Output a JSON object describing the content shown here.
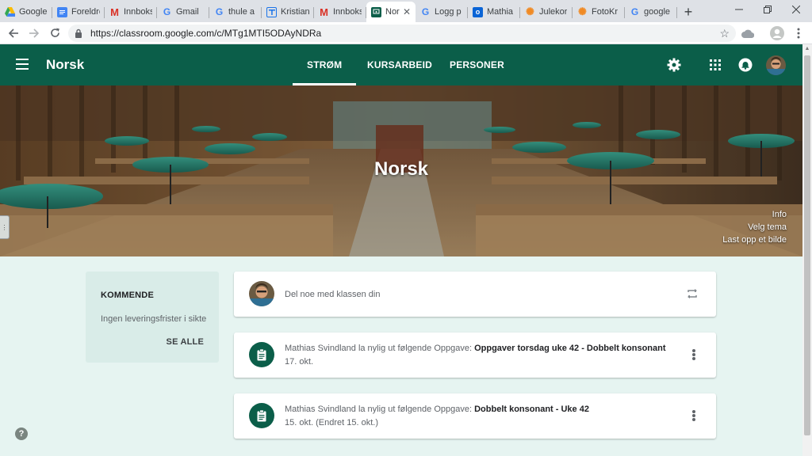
{
  "browser": {
    "tabs": [
      {
        "title": "Google",
        "icon": "google-drive-icon",
        "active": false
      },
      {
        "title": "Foreldre",
        "icon": "google-docs-icon",
        "active": false
      },
      {
        "title": "Innboks",
        "icon": "gmail-icon",
        "active": false
      },
      {
        "title": "Gmail",
        "icon": "google-g-icon",
        "active": false
      },
      {
        "title": "thule a",
        "icon": "google-g-icon",
        "active": false
      },
      {
        "title": "Kristian",
        "icon": "google-forms-icon",
        "active": false
      },
      {
        "title": "Innboks",
        "icon": "gmail-icon",
        "active": false
      },
      {
        "title": "Nor",
        "icon": "classroom-icon",
        "active": true
      },
      {
        "title": "Logg p",
        "icon": "google-g-icon",
        "active": false
      },
      {
        "title": "Mathia",
        "icon": "outlook-icon",
        "active": false
      },
      {
        "title": "Julekor",
        "icon": "orange-flower-icon",
        "active": false
      },
      {
        "title": "FotoKr",
        "icon": "orange-flower-icon",
        "active": false
      },
      {
        "title": "google",
        "icon": "google-g-icon",
        "active": false
      }
    ],
    "tab_close": "✕",
    "new_tab": "+",
    "url": "https://classroom.google.com/c/MTg1MTI5ODAyNDRa"
  },
  "appbar": {
    "title": "Norsk",
    "tabs": [
      "STRØM",
      "KURSARBEID",
      "PERSONER"
    ],
    "active_tab": "STRØM"
  },
  "banner": {
    "title": "Norsk",
    "links": [
      "Info",
      "Velg tema",
      "Last opp et bilde"
    ]
  },
  "upcoming": {
    "title": "KOMMENDE",
    "text": "Ingen leveringsfrister i sikte",
    "link": "SE ALLE"
  },
  "share_box": {
    "placeholder": "Del noe med klassen din"
  },
  "posts": [
    {
      "prefix": "Mathias Svindland la nylig ut følgende Oppgave: ",
      "title": "Oppgaver torsdag uke 42 - Dobbelt konsonant",
      "date": "17. okt."
    },
    {
      "prefix": "Mathias Svindland la nylig ut følgende Oppgave: ",
      "title": "Dobbelt konsonant - Uke 42",
      "date": "15. okt. (Endret 15. okt.)"
    }
  ],
  "help": "?",
  "colors": {
    "brand_green": "#0b5e49",
    "page_bg": "#e6f4f1",
    "upcoming_bg": "#d9ece8"
  }
}
